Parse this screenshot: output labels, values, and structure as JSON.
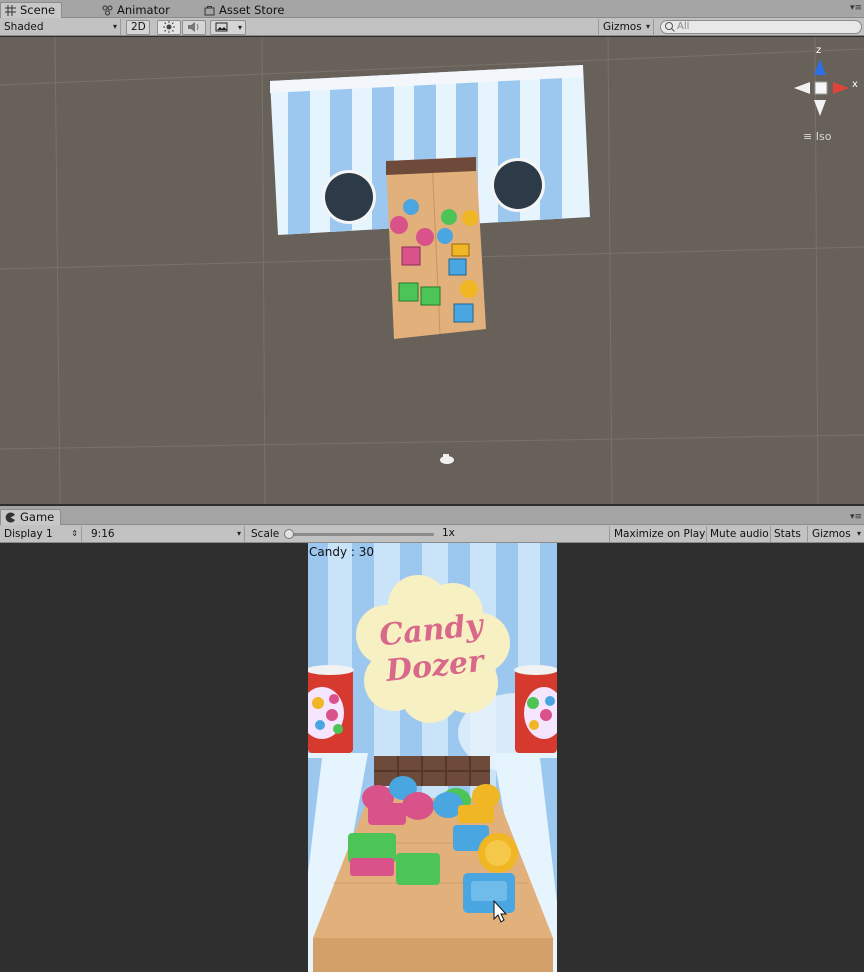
{
  "scene_tabs": {
    "scene": "Scene",
    "animator": "Animator",
    "asset_store": "Asset Store"
  },
  "scene_toolbar": {
    "shading_mode": "Shaded",
    "mode_2d": "2D",
    "gizmos": "Gizmos",
    "search_placeholder": "All"
  },
  "scene_gizmo": {
    "axis_x": "x",
    "axis_z": "z",
    "projection": "Iso"
  },
  "game_tabs": {
    "game": "Game"
  },
  "game_toolbar": {
    "display": "Display 1",
    "aspect": "9:16",
    "scale_label": "Scale",
    "scale_value": "1x",
    "scale_fraction": 0.0,
    "maximize_on_play": "Maximize on Play",
    "mute_audio": "Mute audio",
    "stats": "Stats",
    "gizmos": "Gizmos"
  },
  "game": {
    "candy_counter": "Candy : 30",
    "logo_line1": "Candy",
    "logo_line2": "Dozer"
  },
  "colors": {
    "scene_bg": "#68615a",
    "stripe_blue": "#9cc8f0",
    "stripe_white": "#e6f4fd",
    "wood": "#e2b07a",
    "chocolate": "#6e4a3a",
    "candy_pink": "#d9538a",
    "candy_blue": "#4aa6e0",
    "candy_green": "#4cc456",
    "candy_yellow": "#f0b623",
    "logo_cream": "#f7f0c2",
    "logo_text": "#d9698a"
  }
}
